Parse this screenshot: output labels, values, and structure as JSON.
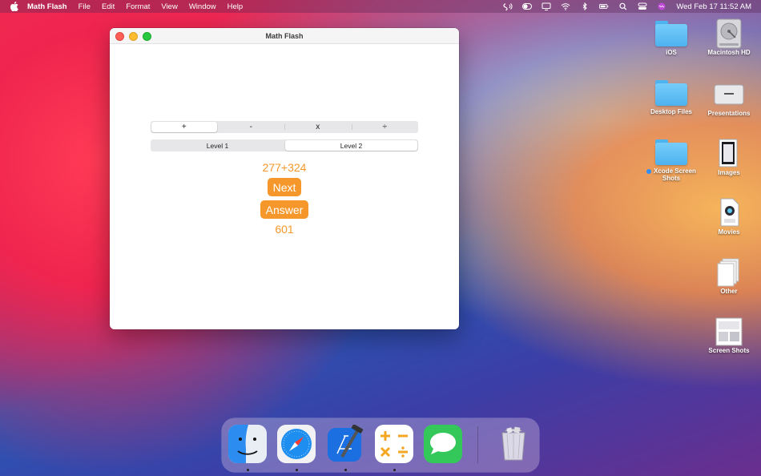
{
  "menubar": {
    "app_name": "Math Flash",
    "menus": [
      "File",
      "Edit",
      "Format",
      "View",
      "Window",
      "Help"
    ],
    "clock": "Wed Feb 17  11:52 AM"
  },
  "window": {
    "title": "Math Flash",
    "operations": [
      "+",
      "-",
      "x",
      "÷"
    ],
    "selected_operation": "+",
    "levels": [
      "Level 1",
      "Level 2"
    ],
    "selected_level": "Level 2",
    "question": "277+324",
    "next_label": "Next",
    "answer_label": "Answer",
    "answer_value": "601",
    "accent_color": "#f5972a"
  },
  "desktop": {
    "icons": [
      {
        "label": "iOS",
        "kind": "folder"
      },
      {
        "label": "Macintosh HD",
        "kind": "drive"
      },
      {
        "label": "Desktop Files",
        "kind": "folder"
      },
      {
        "label": "Presentations",
        "kind": "drive"
      },
      {
        "label": "Xcode Screen Shots",
        "kind": "folder",
        "tag": "blue"
      },
      {
        "label": "Images",
        "kind": "file"
      },
      {
        "label": "Movies",
        "kind": "file"
      },
      {
        "label": "Other",
        "kind": "file"
      },
      {
        "label": "Screen Shots",
        "kind": "file"
      }
    ]
  },
  "dock": {
    "apps": [
      "finder-icon",
      "safari-icon",
      "xcode-icon",
      "math-flash-icon",
      "messages-icon",
      "trash-icon"
    ]
  }
}
